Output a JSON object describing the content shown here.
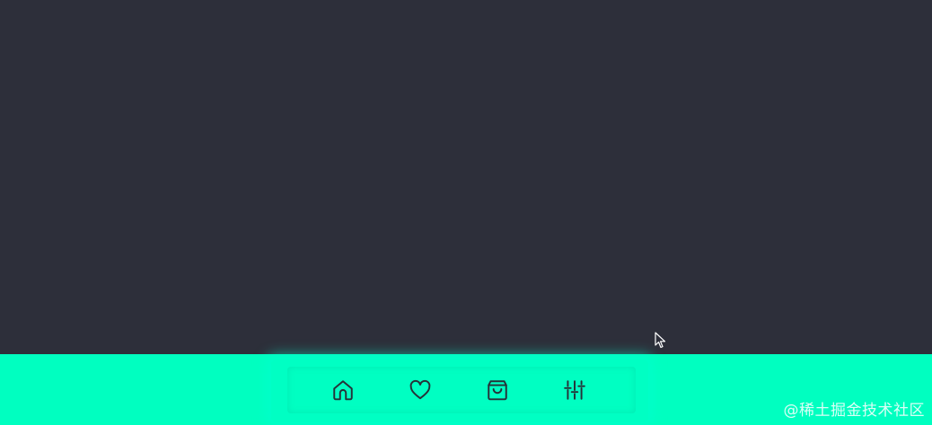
{
  "colors": {
    "content_bg": "#2d2f3a",
    "bar_bg": "#00ffc0",
    "icon_stroke": "#263238"
  },
  "nav": {
    "items": [
      {
        "icon": "home-icon"
      },
      {
        "icon": "heart-icon"
      },
      {
        "icon": "shopping-bag-icon"
      },
      {
        "icon": "sliders-icon"
      }
    ]
  },
  "watermark": {
    "text": "@稀土掘金技术社区"
  }
}
